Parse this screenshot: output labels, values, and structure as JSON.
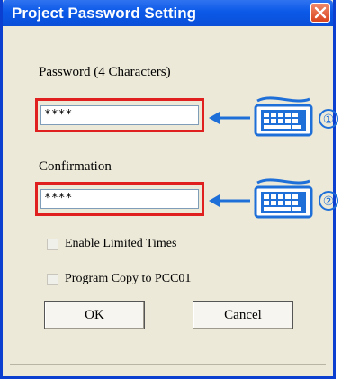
{
  "dialog": {
    "title": "Project Password Setting",
    "password_label": "Password (4 Characters)",
    "password_value": "****",
    "confirmation_label": "Confirmation",
    "confirmation_value": "****",
    "enable_limited_times": "Enable Limited Times",
    "program_copy": "Program Copy to PCC01",
    "ok_label": "OK",
    "cancel_label": "Cancel"
  },
  "annotations": {
    "marker_1": "①",
    "marker_2": "②"
  },
  "colors": {
    "titlebar": "#0b59e8",
    "highlight_box": "#e01f1f",
    "annotation_blue": "#1f6fd8",
    "dialog_bg": "#ece9d8"
  },
  "icons": [
    "close-icon",
    "keyboard-icon",
    "arrow-left-icon"
  ]
}
